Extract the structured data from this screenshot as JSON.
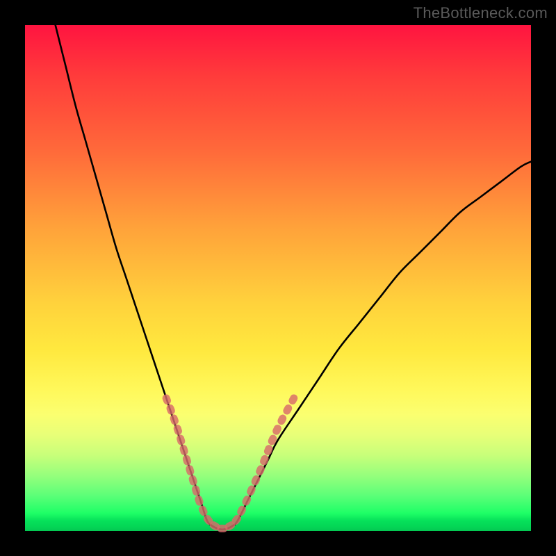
{
  "watermark": {
    "text": "TheBottleneck.com"
  },
  "colors": {
    "curve": "#000000",
    "marker": "#d86a6a",
    "marker_stroke": "#d86a6a"
  },
  "chart_data": {
    "type": "line",
    "title": "",
    "xlabel": "",
    "ylabel": "",
    "xlim": [
      0,
      100
    ],
    "ylim": [
      0,
      100
    ],
    "grid": false,
    "legend": false,
    "series": [
      {
        "name": "left-branch",
        "x": [
          6,
          8,
          10,
          12,
          14,
          16,
          18,
          20,
          22,
          24,
          26,
          28,
          30,
          31,
          32,
          33,
          34,
          35,
          36
        ],
        "y": [
          100,
          92,
          84,
          77,
          70,
          63,
          56,
          50,
          44,
          38,
          32,
          26,
          20,
          17,
          14,
          11,
          8,
          5,
          2
        ]
      },
      {
        "name": "valley",
        "x": [
          36,
          37,
          38,
          39,
          40,
          41,
          42
        ],
        "y": [
          2,
          1,
          0.5,
          0.3,
          0.5,
          1,
          2
        ]
      },
      {
        "name": "right-branch",
        "x": [
          42,
          44,
          46,
          48,
          50,
          54,
          58,
          62,
          66,
          70,
          74,
          78,
          82,
          86,
          90,
          94,
          98,
          100
        ],
        "y": [
          2,
          6,
          10,
          14,
          18,
          24,
          30,
          36,
          41,
          46,
          51,
          55,
          59,
          63,
          66,
          69,
          72,
          73
        ]
      }
    ],
    "markers": {
      "name": "dotted-overlay",
      "points": [
        {
          "x": 28.0,
          "y": 26
        },
        {
          "x": 28.8,
          "y": 24
        },
        {
          "x": 29.5,
          "y": 22
        },
        {
          "x": 30.2,
          "y": 20
        },
        {
          "x": 30.8,
          "y": 18
        },
        {
          "x": 31.4,
          "y": 16
        },
        {
          "x": 32.0,
          "y": 14
        },
        {
          "x": 32.6,
          "y": 12
        },
        {
          "x": 33.2,
          "y": 10
        },
        {
          "x": 33.8,
          "y": 8
        },
        {
          "x": 34.4,
          "y": 6
        },
        {
          "x": 35.2,
          "y": 4
        },
        {
          "x": 36.2,
          "y": 2.2
        },
        {
          "x": 37.5,
          "y": 1.0
        },
        {
          "x": 39.0,
          "y": 0.5
        },
        {
          "x": 40.5,
          "y": 1.0
        },
        {
          "x": 41.8,
          "y": 2.2
        },
        {
          "x": 42.8,
          "y": 4
        },
        {
          "x": 43.8,
          "y": 6
        },
        {
          "x": 44.7,
          "y": 8
        },
        {
          "x": 45.6,
          "y": 10
        },
        {
          "x": 46.5,
          "y": 12
        },
        {
          "x": 47.3,
          "y": 14
        },
        {
          "x": 48.1,
          "y": 16
        },
        {
          "x": 48.9,
          "y": 18
        },
        {
          "x": 49.8,
          "y": 20
        },
        {
          "x": 50.8,
          "y": 22
        },
        {
          "x": 51.9,
          "y": 24
        },
        {
          "x": 53.0,
          "y": 26
        }
      ]
    }
  }
}
